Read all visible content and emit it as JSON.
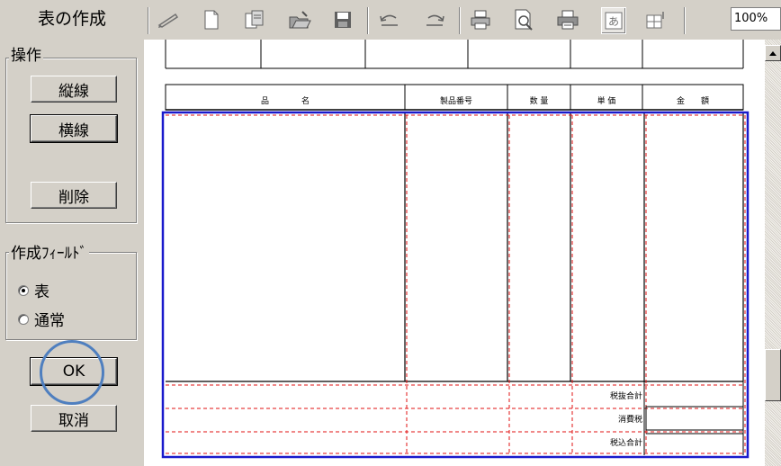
{
  "panel": {
    "title": "表の作成",
    "operation_group": {
      "legend": "操作",
      "vertical_line_button": "縦線",
      "horizontal_line_button": "横線",
      "delete_button": "削除"
    },
    "field_group": {
      "legend": "作成ﾌｨｰﾙﾄﾞ",
      "options": [
        {
          "label": "表",
          "checked": true
        },
        {
          "label": "通常",
          "checked": false
        }
      ]
    },
    "ok_button": "OK",
    "cancel_button": "取消"
  },
  "toolbar": {
    "icons": [
      "pencil-icon",
      "new-document-icon",
      "copy-document-icon",
      "open-folder-icon",
      "save-icon",
      "undo-icon",
      "redo-icon",
      "print-icon",
      "print-preview-icon",
      "printer-setup-icon",
      "text-box-icon",
      "grid-icon"
    ],
    "zoom": "100%"
  },
  "form": {
    "headers": [
      "品　　　　名",
      "製品番号",
      "数 量",
      "単 価",
      "金　　額"
    ],
    "summary_rows": [
      "税抜合計",
      "消費税",
      "税込合計"
    ]
  },
  "colors": {
    "selection_blue": "#1a1acc",
    "guide_red": "#e01010",
    "highlight_circle": "#4f7fbf"
  }
}
